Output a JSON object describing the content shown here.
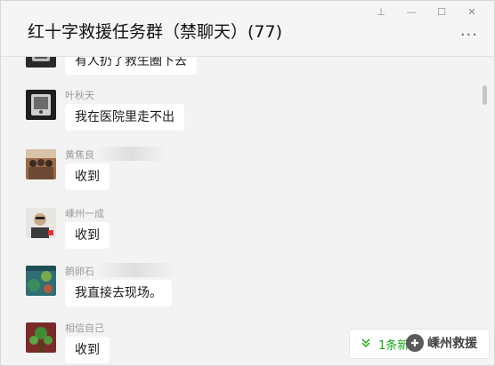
{
  "window": {
    "title": "红十字救援任务群（禁聊天）(77)",
    "controls": {
      "pin": "⊥",
      "minimize": "—",
      "maximize": "☐",
      "close": "✕"
    },
    "more": "···"
  },
  "messages": [
    {
      "sender": "",
      "text": "有人扔了救生圈下去",
      "avatar": "speaker-avatar"
    },
    {
      "sender": "叶秋天",
      "text": "我在医院里走不出",
      "avatar": "speaker-avatar"
    },
    {
      "sender": "黄焦良",
      "text": "收到",
      "avatar": "group-photo-avatar"
    },
    {
      "sender": "嵊州一成",
      "text": "收到",
      "avatar": "person-avatar"
    },
    {
      "sender": "鹅卵石",
      "text": "我直接去现场。",
      "avatar": "reef-avatar"
    },
    {
      "sender": "相信自己",
      "text": "收到",
      "avatar": "plant-avatar"
    }
  ],
  "new_message_notice": {
    "icon": "double-chevron-down-icon",
    "text": "1条新"
  },
  "watermark": {
    "text": "嵊州救援"
  },
  "colors": {
    "accent": "#1aad19",
    "bubble": "#ffffff",
    "background": "#f3f3f3"
  }
}
